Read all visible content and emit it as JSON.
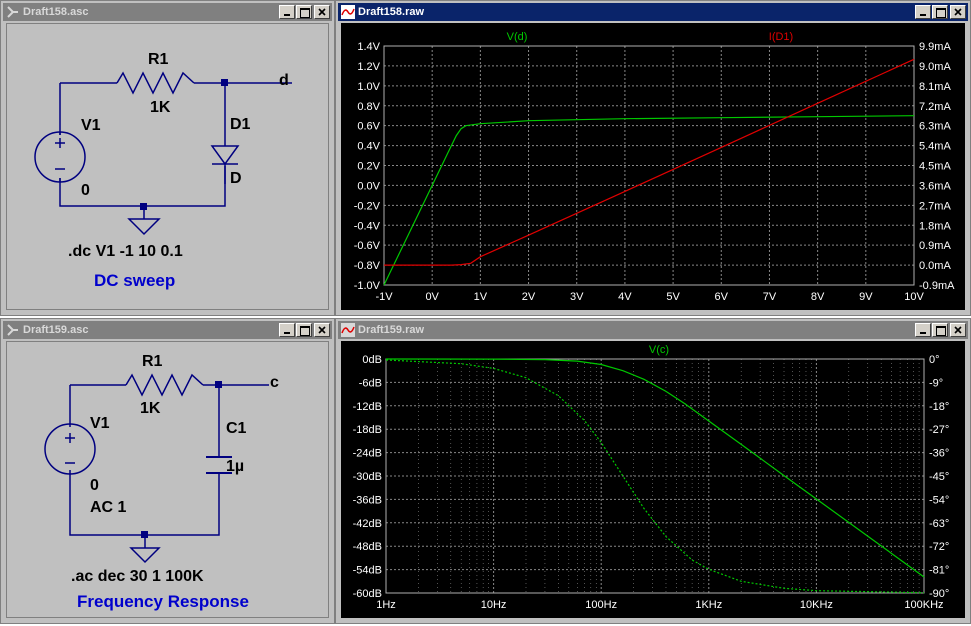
{
  "windows": {
    "schematic1": {
      "title": "Draft158.asc"
    },
    "plot1": {
      "title": "Draft158.raw"
    },
    "schematic2": {
      "title": "Draft159.asc"
    },
    "plot2": {
      "title": "Draft159.raw"
    }
  },
  "schematic1": {
    "resistor_name": "R1",
    "resistor_value": "1K",
    "source_name": "V1",
    "source_value": "0",
    "diode_name": "D1",
    "diode_value": "D",
    "node_label": "d",
    "directive": ".dc V1 -1 10 0.1",
    "comment": "DC sweep"
  },
  "schematic2": {
    "resistor_name": "R1",
    "resistor_value": "1K",
    "source_name": "V1",
    "source_value": "0",
    "source_ac": "AC 1",
    "cap_name": "C1",
    "cap_value": "1µ",
    "node_label": "c",
    "directive": ".ac dec 30 1 100K",
    "comment": "Frequency Response"
  },
  "colors": {
    "trace_green": "#00c800",
    "trace_red": "#e00000",
    "comment_blue": "#0000cc",
    "plot_bg": "#000000",
    "grid": "#888888"
  },
  "chart_data": [
    {
      "type": "line",
      "title": "",
      "xlabel": "",
      "ylabel": "",
      "x_ticks": [
        "-1V",
        "0V",
        "1V",
        "2V",
        "3V",
        "4V",
        "5V",
        "6V",
        "7V",
        "8V",
        "9V",
        "10V"
      ],
      "y_ticks_left": [
        "1.4V",
        "1.2V",
        "1.0V",
        "0.8V",
        "0.6V",
        "0.4V",
        "0.2V",
        "0.0V",
        "-0.2V",
        "-0.4V",
        "-0.6V",
        "-0.8V",
        "-1.0V"
      ],
      "y_ticks_right": [
        "9.9mA",
        "9.0mA",
        "8.1mA",
        "7.2mA",
        "6.3mA",
        "5.4mA",
        "4.5mA",
        "3.6mA",
        "2.7mA",
        "1.8mA",
        "0.9mA",
        "0.0mA",
        "-0.9mA"
      ],
      "xlim": [
        -1,
        10
      ],
      "ylim_left": [
        -1.0,
        1.4
      ],
      "ylim_right": [
        -0.9,
        9.9
      ],
      "grid": true,
      "series": [
        {
          "name": "V(d)",
          "axis": "left",
          "color": "#00c800",
          "x": [
            -1,
            -0.5,
            0,
            0.3,
            0.5,
            0.6,
            0.7,
            1,
            2,
            4,
            6,
            8,
            10
          ],
          "y": [
            -1.0,
            -0.5,
            0.0,
            0.3,
            0.5,
            0.57,
            0.6,
            0.62,
            0.65,
            0.67,
            0.68,
            0.69,
            0.7
          ]
        },
        {
          "name": "I(D1)",
          "axis": "right",
          "color": "#e00000",
          "x": [
            -1,
            0,
            0.4,
            0.6,
            0.8,
            1,
            2,
            4,
            6,
            8,
            10
          ],
          "y": [
            0.0,
            0.0,
            0.0,
            0.02,
            0.08,
            0.38,
            1.35,
            3.33,
            5.32,
            7.31,
            9.3
          ]
        }
      ]
    },
    {
      "type": "line",
      "title": "",
      "xlabel": "",
      "ylabel": "",
      "x_scale": "log",
      "x_ticks": [
        "1Hz",
        "10Hz",
        "100Hz",
        "1KHz",
        "10KHz",
        "100KHz"
      ],
      "y_ticks_left": [
        "0dB",
        "-6dB",
        "-12dB",
        "-18dB",
        "-24dB",
        "-30dB",
        "-36dB",
        "-42dB",
        "-48dB",
        "-54dB",
        "-60dB"
      ],
      "y_ticks_right": [
        "0°",
        "-9°",
        "-18°",
        "-27°",
        "-36°",
        "-45°",
        "-54°",
        "-63°",
        "-72°",
        "-81°",
        "-90°"
      ],
      "xlim": [
        1,
        100000
      ],
      "ylim_left": [
        -60,
        0
      ],
      "ylim_right": [
        -90,
        0
      ],
      "grid": true,
      "series": [
        {
          "name": "V(c)",
          "style": "solid",
          "axis": "left",
          "color": "#00c800",
          "x": [
            1,
            10,
            30,
            60,
            100,
            159,
            250,
            400,
            600,
            1000,
            2000,
            5000,
            10000,
            30000,
            100000
          ],
          "y": [
            0,
            -0.02,
            -0.15,
            -0.55,
            -1.4,
            -3.0,
            -5.2,
            -8.3,
            -11.5,
            -15.9,
            -21.9,
            -29.9,
            -35.9,
            -45.4,
            -55.9
          ]
        },
        {
          "name": "phase",
          "style": "dashed",
          "axis": "right",
          "color": "#00c800",
          "x": [
            1,
            5,
            10,
            20,
            40,
            70,
            100,
            159,
            250,
            400,
            700,
            1000,
            2000,
            5000,
            10000,
            100000
          ],
          "y": [
            -0.4,
            -1.8,
            -3.6,
            -7.2,
            -14.1,
            -23.7,
            -32.1,
            -45.0,
            -57.5,
            -68.3,
            -77.3,
            -80.9,
            -85.5,
            -88.2,
            -89.1,
            -89.9
          ]
        }
      ]
    }
  ]
}
